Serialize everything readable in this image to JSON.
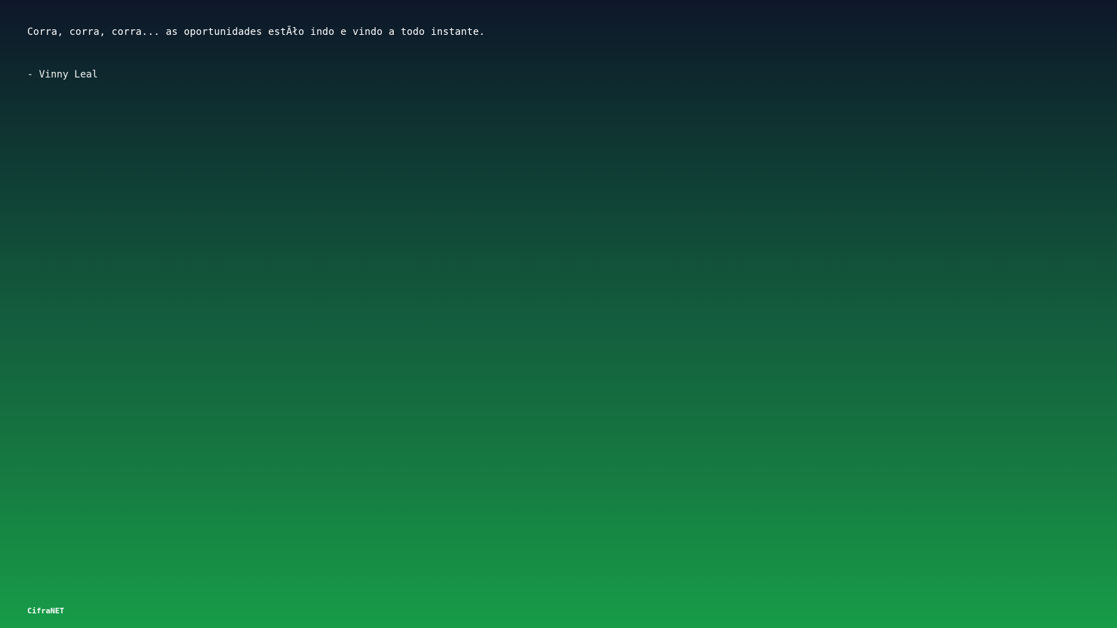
{
  "quote": {
    "text": "Corra, corra, corra... as oportunidades estÃło indo e vindo a todo instante.",
    "author": "- Vinny Leal"
  },
  "footer": {
    "brand": "CifraNET"
  }
}
